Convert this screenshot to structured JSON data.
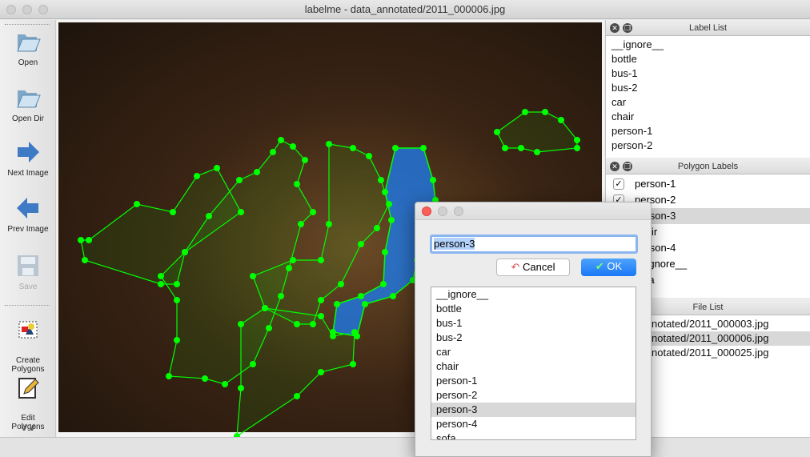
{
  "window": {
    "title": "labelme - data_annotated/2011_000006.jpg"
  },
  "toolbar": [
    {
      "label": "Open",
      "icon": "folder-open-icon",
      "enabled": true
    },
    {
      "label": "Open Dir",
      "icon": "folder-icon",
      "enabled": true
    },
    {
      "label": "Next Image",
      "icon": "arrow-right-icon",
      "enabled": true
    },
    {
      "label": "Prev Image",
      "icon": "arrow-left-icon",
      "enabled": true
    },
    {
      "label": "Save",
      "icon": "floppy-disk-icon",
      "enabled": false
    },
    {
      "label": "Create\nPolygons",
      "icon": "create-polygon-icon",
      "enabled": true
    },
    {
      "label": "Edit\nPolygons",
      "icon": "edit-icon",
      "enabled": true
    }
  ],
  "label_list": {
    "title": "Label List",
    "items": [
      "__ignore__",
      "bottle",
      "bus-1",
      "bus-2",
      "car",
      "chair",
      "person-1",
      "person-2"
    ]
  },
  "polygon_labels": {
    "title": "Polygon Labels",
    "items": [
      {
        "label": "person-1",
        "checked": true
      },
      {
        "label": "person-2",
        "checked": true
      },
      {
        "label": "person-3",
        "checked": true,
        "selected": true
      },
      {
        "label": "chair",
        "checked": true
      },
      {
        "label": "person-4",
        "checked": true
      },
      {
        "label": "__ignore__",
        "checked": true
      },
      {
        "label": "sofa",
        "checked": true
      }
    ]
  },
  "file_list": {
    "title": "File List",
    "items": [
      "data_annotated/2011_000003.jpg",
      "data_annotated/2011_000006.jpg",
      "data_annotated/2011_000025.jpg"
    ],
    "selected": 1
  },
  "dialog": {
    "input_value": "person-3",
    "cancel": "Cancel",
    "ok": "OK",
    "items": [
      "__ignore__",
      "bottle",
      "bus-1",
      "bus-2",
      "car",
      "chair",
      "person-1",
      "person-2",
      "person-3",
      "person-4",
      "sofa"
    ],
    "selected": 8
  },
  "colors": {
    "polygon": "#00ff00",
    "selected_fill": "#1e78e6",
    "accent": "#1a82fb"
  }
}
